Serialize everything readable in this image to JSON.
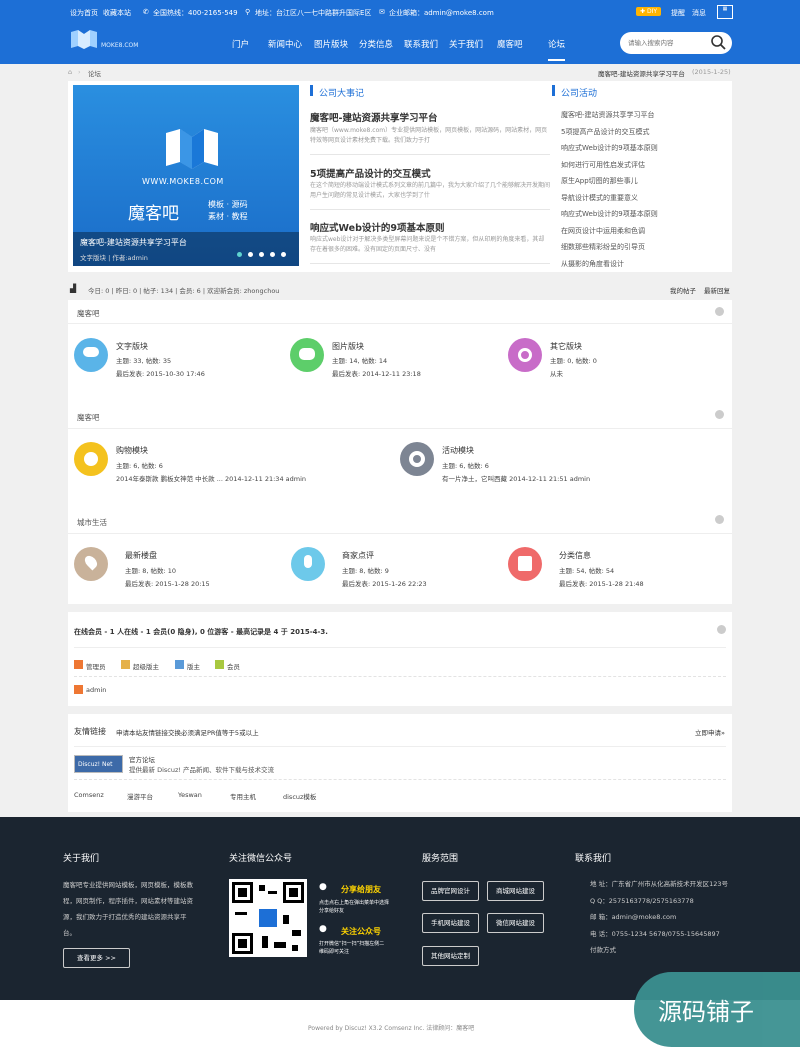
{
  "topbar": {
    "set_home": "设为首页",
    "bookmark": "收藏本站",
    "hotline": "全国热线：400-2165-549",
    "address": "地址：台江区八一七中路群升国际E区",
    "email": "企业邮箱：admin@moke8.com",
    "diy": "DIY",
    "remind": "提醒",
    "message": "消息"
  },
  "header": {
    "logo_text": "MOKE8.COM",
    "nav": [
      "门户",
      "新闻中心",
      "图片版块",
      "分类信息",
      "联系我们",
      "关于我们",
      "魔客吧",
      "论坛"
    ],
    "active": "论坛",
    "search_placeholder": "请输入搜索内容"
  },
  "breadcrumb": {
    "current": "论坛",
    "right_title": "魔客吧-建站资源共享学习平台",
    "right_date": "(2015-1-25)"
  },
  "slider": {
    "site": "WWW.MOKE8.COM",
    "brand": "魔客吧",
    "tags1": "模板 · 源码",
    "tags2": "素材 · 教程",
    "caption": "魔客吧-建站资源共享学习平台",
    "sub": "文字版块 | 作者:admin"
  },
  "events": {
    "title": "公司大事记",
    "items": [
      {
        "title": "魔客吧-建站资源共享学习平台",
        "desc": "魔客吧（www.moke8.com）专业提供网站模板，网页模板，网站源码，网站素材，网页特效等网页设计素材免费下载。我们致力于打"
      },
      {
        "title": "5项提高产品设计的交互模式",
        "desc": "在这个简短的移动端设计模式系列文章的前几篇中，我为大家介绍了几个能够解决开发期间用户生问题的常见设计模式，大家也学到了什"
      },
      {
        "title": "响应式Web设计的9项基本原则",
        "desc": "响应式web设计对于解决多类型屏幕问题来说是个不错方案，但从印刷的角度来看，其却存在着很多的困难。没有固定的页面尺寸、没有"
      }
    ]
  },
  "activity": {
    "title": "公司活动",
    "items": [
      "魔客吧-建站资源共享学习平台",
      "5项提高产品设计的交互模式",
      "响应式Web设计的9项基本原则",
      "如何进行可用性启发式评估",
      "原生App切图的那些事儿",
      "导航设计模式的重要意义",
      "响应式Web设计的9项基本原则",
      "在网页设计中运用柔和色调",
      "细数那些精彩纷呈的引导页",
      "从摄影的角度看设计"
    ]
  },
  "stats": {
    "text": "今日: 0 | 昨日: 0 | 帖子: 134 | 会员: 6 | 欢迎新会员: zhongchou",
    "my_posts": "我的帖子",
    "latest_reply": "最新回复"
  },
  "sections": [
    {
      "title": "魔客吧",
      "forums": [
        {
          "name": "文字版块",
          "stats": "主题: 33, 帖数: 35",
          "last": "最后发表: 2015-10-30 17:46",
          "color": "#5ab4e8"
        },
        {
          "name": "图片版块",
          "stats": "主题: 14, 帖数: 14",
          "last": "最后发表: 2014-12-11 23:18",
          "color": "#5dce6a"
        },
        {
          "name": "其它版块",
          "stats": "主题: 0, 帖数: 0",
          "last": "从未",
          "color": "#c86cc8"
        }
      ]
    },
    {
      "title": "魔客吧",
      "forums": [
        {
          "name": "购物模块",
          "stats": "主题: 6, 帖数: 6",
          "last": "2014年泰斯款 鹏板女神范 中长款 ... 2014-12-11 21:34 admin",
          "color": "#f4c21e"
        },
        {
          "name": "活动模块",
          "stats": "主题: 6, 帖数: 6",
          "last": "有一片净土，它叫西藏 2014-12-11 21:51 admin",
          "color": "#7d8593"
        }
      ]
    },
    {
      "title": "城市生活",
      "forums": [
        {
          "name": "最新楼盘",
          "stats": "主题: 8, 帖数: 10",
          "last": "最后发表: 2015-1-28 20:15",
          "color": "#c9b29a"
        },
        {
          "name": "商家点评",
          "stats": "主题: 8, 帖数: 9",
          "last": "最后发表: 2015-1-26 22:23",
          "color": "#6dc9ea"
        },
        {
          "name": "分类信息",
          "stats": "主题: 54, 帖数: 54",
          "last": "最后发表: 2015-1-28 21:48",
          "color": "#ef6a6a"
        }
      ]
    }
  ],
  "online": {
    "title": "在线会员 - 1 人在线 - 1 会员(0 隐身), 0 位游客 - 最高记录是 4 于 2015-4-3.",
    "legend": [
      "管理员",
      "超级版主",
      "版主",
      "会员"
    ],
    "user": "admin"
  },
  "links": {
    "title": "友情链接",
    "note": "申请本站友情链接交换必须满足PR值等于5或以上",
    "apply": "立即申请»",
    "logo_text": "Discuz! Net",
    "official": "官方论坛",
    "official_desc": "提供最新 Discuz! 产品新闻、软件下载与技术交流",
    "text_links": [
      "Comsenz",
      "漫游平台",
      "Yeswan",
      "专用主机",
      "discuz模板"
    ]
  },
  "footer": {
    "about_title": "关于我们",
    "about_text": [
      "魔客吧专业提供网站模板，网页模板，模板教",
      "程，网页制作，程序插件，网站素材等建站资",
      "源，我们致力于打造优秀的建站资源共享平",
      "台。"
    ],
    "more": "查看更多 >>",
    "wechat_title": "关注微信公众号",
    "share_title": "分享给朋友",
    "share_desc1": "点击点右上角在弹出菜单中选择",
    "share_desc2": "分享给好友",
    "follow_title": "关注公众号",
    "follow_desc1": "打开微信“扫一扫”扫描左侧二",
    "follow_desc2": "维码即可关注",
    "service_title": "服务范围",
    "services": [
      "品牌官网设计",
      "商城网站建设",
      "手机网站建设",
      "微信网站建设",
      "其他网站定制"
    ],
    "contact_title": "联系我们",
    "contact": [
      "地 址：广东省广州市从化高新技术开发区123号",
      "Q Q：2575163778/2575163778",
      "邮 箱：admin@moke8.com",
      "电 话：0755-1234 5678/0755-15645897",
      "付款方式"
    ]
  },
  "bottom": {
    "powered": "Powered by Discuz! X3.2 Comsenz Inc. 法律顾问：魔客吧",
    "watermark": "源码铺子"
  }
}
